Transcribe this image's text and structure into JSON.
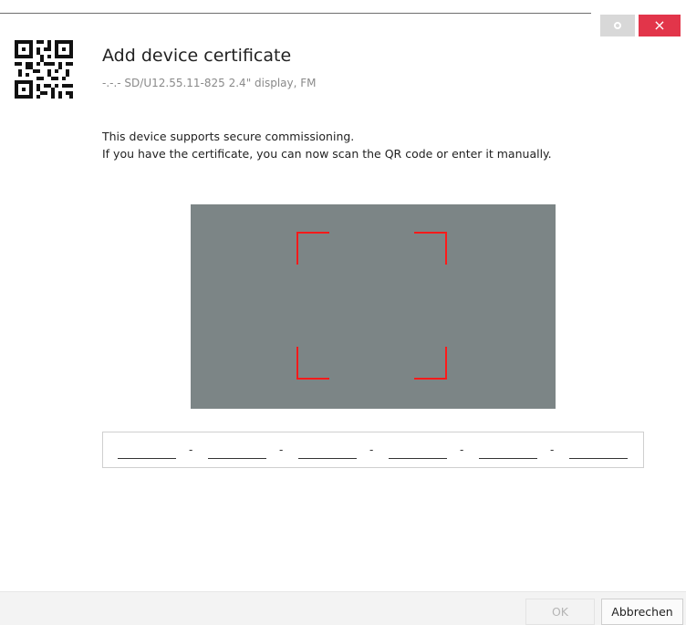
{
  "window": {
    "close_label": "×"
  },
  "header": {
    "title": "Add device certificate",
    "subtitle": "-.-.- SD/U12.55.11-825 2.4\" display, FM"
  },
  "body": {
    "description_line1": "This device supports secure commissioning.",
    "description_line2": "If you have the certificate, you can now scan the QR code or enter it manually."
  },
  "certificate": {
    "separators": [
      "-",
      "-",
      "-",
      "-",
      "-"
    ]
  },
  "footer": {
    "ok_label": "OK",
    "cancel_label": "Abbrechen"
  },
  "colors": {
    "close_button": "#e2354a",
    "scanner_background": "#7c8586",
    "scanner_frame": "#ff1a1a"
  },
  "icons": {
    "header": "qr-code-icon",
    "settings": "gear-icon",
    "close": "close-icon"
  }
}
